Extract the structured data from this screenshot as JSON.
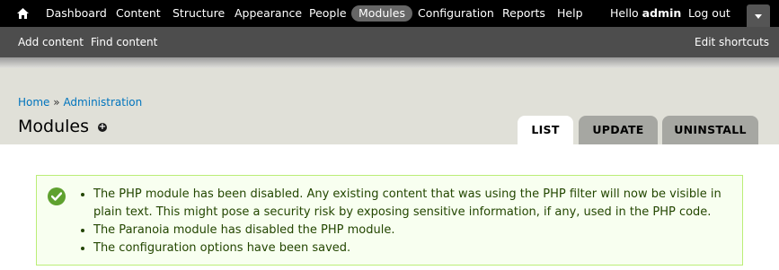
{
  "toolbar": {
    "home_icon": "home-icon",
    "items": [
      "Dashboard",
      "Content",
      "Structure",
      "Appearance",
      "People",
      "Modules",
      "Configuration",
      "Reports",
      "Help"
    ],
    "active_item": "Modules",
    "hello_prefix": "Hello",
    "username": "admin",
    "logout": "Log out",
    "toggle_icon": "triangle-down-icon"
  },
  "shortcuts": {
    "items": [
      "Add content",
      "Find content"
    ],
    "edit": "Edit shortcuts"
  },
  "breadcrumb": {
    "home": "Home",
    "separator": "»",
    "admin": "Administration"
  },
  "page": {
    "title": "Modules",
    "add_shortcut_icon": "plus-icon"
  },
  "tabs": [
    "LIST",
    "UPDATE",
    "UNINSTALL"
  ],
  "active_tab": "LIST",
  "messages": {
    "status_icon": "checkmark-icon",
    "items": [
      "The PHP module has been disabled. Any existing content that was using the PHP filter will now be visible in plain text. This might pose a security risk by exposing sensitive information, if any, used in the PHP code.",
      "The Paranoia module has disabled the PHP module.",
      "The configuration options have been saved."
    ]
  },
  "colors": {
    "toolbar_bg": "#000000",
    "shortcuts_bg": "#4d4d4d",
    "header_bg": "#e0e0d8",
    "link": "#0074bd",
    "message_bg": "#f8fff0",
    "message_border": "#bbee77",
    "message_text": "#234600",
    "status_icon": "#5fa12f"
  }
}
